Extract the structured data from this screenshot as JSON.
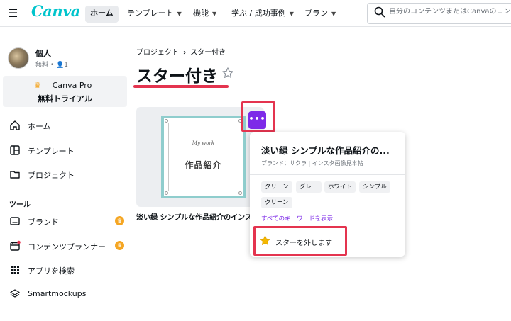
{
  "header": {
    "logo": "Canva",
    "nav": [
      {
        "label": "ホーム",
        "active": true
      },
      {
        "label": "テンプレート",
        "chevron": true
      },
      {
        "label": "機能",
        "chevron": true
      },
      {
        "label": "学ぶ / 成功事例",
        "chevron": true
      },
      {
        "label": "プラン",
        "chevron": true
      }
    ],
    "search_placeholder": "自分のコンテンツまたはCanvaのコンテンツ"
  },
  "sidebar": {
    "profile": {
      "name": "個人",
      "sub": "無料 • 👤1"
    },
    "pro": {
      "line1": "Canva Pro",
      "line2": "無料トライアル"
    },
    "main_items": [
      {
        "label": "ホーム",
        "icon": "home-icon"
      },
      {
        "label": "テンプレート",
        "icon": "template-icon"
      },
      {
        "label": "プロジェクト",
        "icon": "folder-icon"
      }
    ],
    "tools_label": "ツール",
    "tool_items": [
      {
        "label": "ブランド",
        "icon": "brand-icon",
        "crown": true
      },
      {
        "label": "コンテンツプランナー",
        "icon": "calendar-icon",
        "crown": true
      },
      {
        "label": "アプリを検索",
        "icon": "apps-grid-icon"
      },
      {
        "label": "Smartmockups",
        "icon": "layers-icon"
      }
    ],
    "crown_glyph": "♛"
  },
  "main": {
    "breadcrumb": {
      "parent": "プロジェクト",
      "sep": "›",
      "current": "スター付き"
    },
    "title": "スター付き",
    "card": {
      "thumb_small": "My work",
      "thumb_title": "作品紹介",
      "caption": "淡い緑 シンプルな作品紹介のインスタ",
      "more_label": "•••"
    },
    "popup": {
      "title": "淡い緑 シンプルな作品紹介の...",
      "subtitle": "ブランド：サクラ | インスタ画像見本帖",
      "tags": [
        "グリーン",
        "グレー",
        "ホワイト",
        "シンプル",
        "クリーン"
      ],
      "link": "すべてのキーワードを表示",
      "action": "スターを外します"
    }
  },
  "colors": {
    "accent": "#7d2ae8",
    "highlight": "#e4344f",
    "brand": "#00c4cc",
    "star": "#f5b800"
  }
}
